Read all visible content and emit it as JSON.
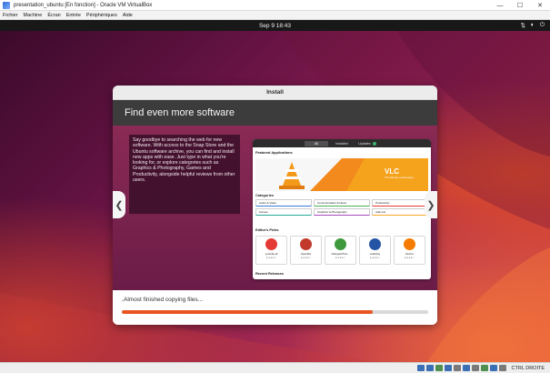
{
  "host": {
    "window_title": "presentation_ubuntu [En fonction] - Oracle VM VirtualBox",
    "menu": [
      "Fichier",
      "Machine",
      "Écran",
      "Entrée",
      "Périphériques",
      "Aide"
    ],
    "window_buttons": [
      "—",
      "☐",
      "✕"
    ],
    "host_key": "CTRL DROITE"
  },
  "guest": {
    "clock": "Sep 9  18:43",
    "status_icons": [
      "network-icon",
      "volume-icon",
      "power-icon"
    ]
  },
  "installer": {
    "title": "Install",
    "banner": "Find even more software",
    "slide_text": "Say goodbye to searching the web for new software. With access to the Snap Store and the Ubuntu software archive, you can find and install new apps with ease. Just type in what you're looking for, or explore categories such as Graphics & Photography, Games and Productivity, alongside helpful reviews from other users.",
    "prev": "❮",
    "next": "❯",
    "status": "Almost finished copying files...",
    "progress": 0.82
  },
  "store": {
    "tabs": [
      "All",
      "Installed",
      "Updates"
    ],
    "featured": "Featured Applications",
    "vlc_title": "VLC",
    "vlc_sub": "The ultimate media player",
    "categories_title": "Categories",
    "categories": [
      "Audio & Video",
      "Communication & News",
      "Productivity",
      "Games",
      "Graphics & Photography",
      "Add-ons"
    ],
    "editors_picks": "Editor's Picks",
    "picks": [
      {
        "name": "youtube-dl",
        "stars": "★★★★☆",
        "color": "#e53935"
      },
      {
        "name": "OpenRA",
        "stars": "★★★★☆",
        "color": "#c0392b"
      },
      {
        "name": "Notepad Plus...",
        "stars": "★★★★☆",
        "color": "#3c9a3c"
      },
      {
        "name": "Audacity",
        "stars": "★★★★☆",
        "color": "#2455a4"
      },
      {
        "name": "Firefox",
        "stars": "★★★★☆",
        "color": "#f57c00"
      }
    ],
    "recent": "Recent Releases"
  }
}
